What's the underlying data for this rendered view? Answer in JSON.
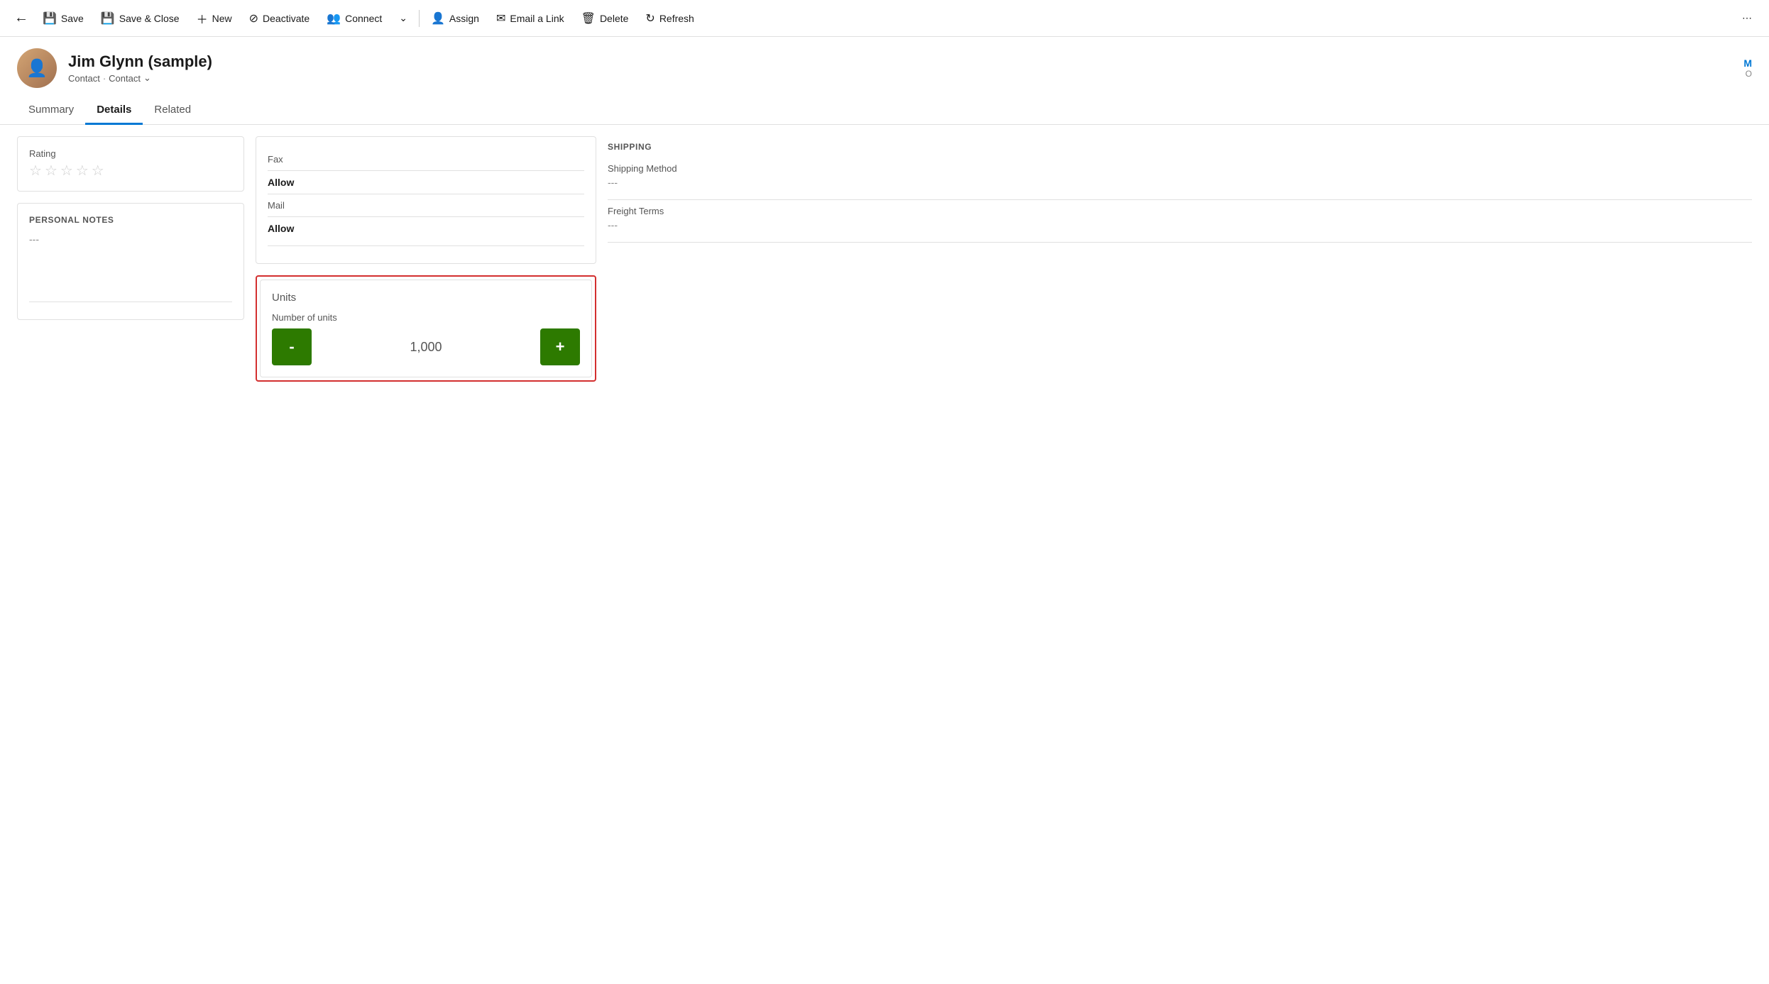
{
  "toolbar": {
    "back_icon": "←",
    "save_label": "Save",
    "save_close_label": "Save & Close",
    "new_label": "New",
    "deactivate_label": "Deactivate",
    "connect_label": "Connect",
    "dropdown_icon": "⌄",
    "assign_label": "Assign",
    "email_link_label": "Email a Link",
    "delete_label": "Delete",
    "refresh_label": "Refresh",
    "more_icon": "⋯"
  },
  "record": {
    "name": "Jim Glynn (sample)",
    "type1": "Contact",
    "type2": "Contact",
    "initial": "M",
    "status": "O"
  },
  "tabs": {
    "summary": "Summary",
    "details": "Details",
    "related": "Related"
  },
  "rating_section": {
    "label": "Rating",
    "stars": [
      "☆",
      "☆",
      "☆",
      "☆",
      "☆"
    ]
  },
  "personal_notes": {
    "title": "PERSONAL NOTES",
    "value": "---"
  },
  "comms": {
    "fax_label": "Fax",
    "fax_value": "Allow",
    "mail_label": "Mail",
    "mail_value": "Allow"
  },
  "units": {
    "title": "Units",
    "field_label": "Number of units",
    "value": "1,000",
    "decrement_label": "-",
    "increment_label": "+"
  },
  "shipping": {
    "title": "SHIPPING",
    "method_label": "Shipping Method",
    "method_value": "---",
    "terms_label": "Freight Terms",
    "terms_value": "---"
  }
}
